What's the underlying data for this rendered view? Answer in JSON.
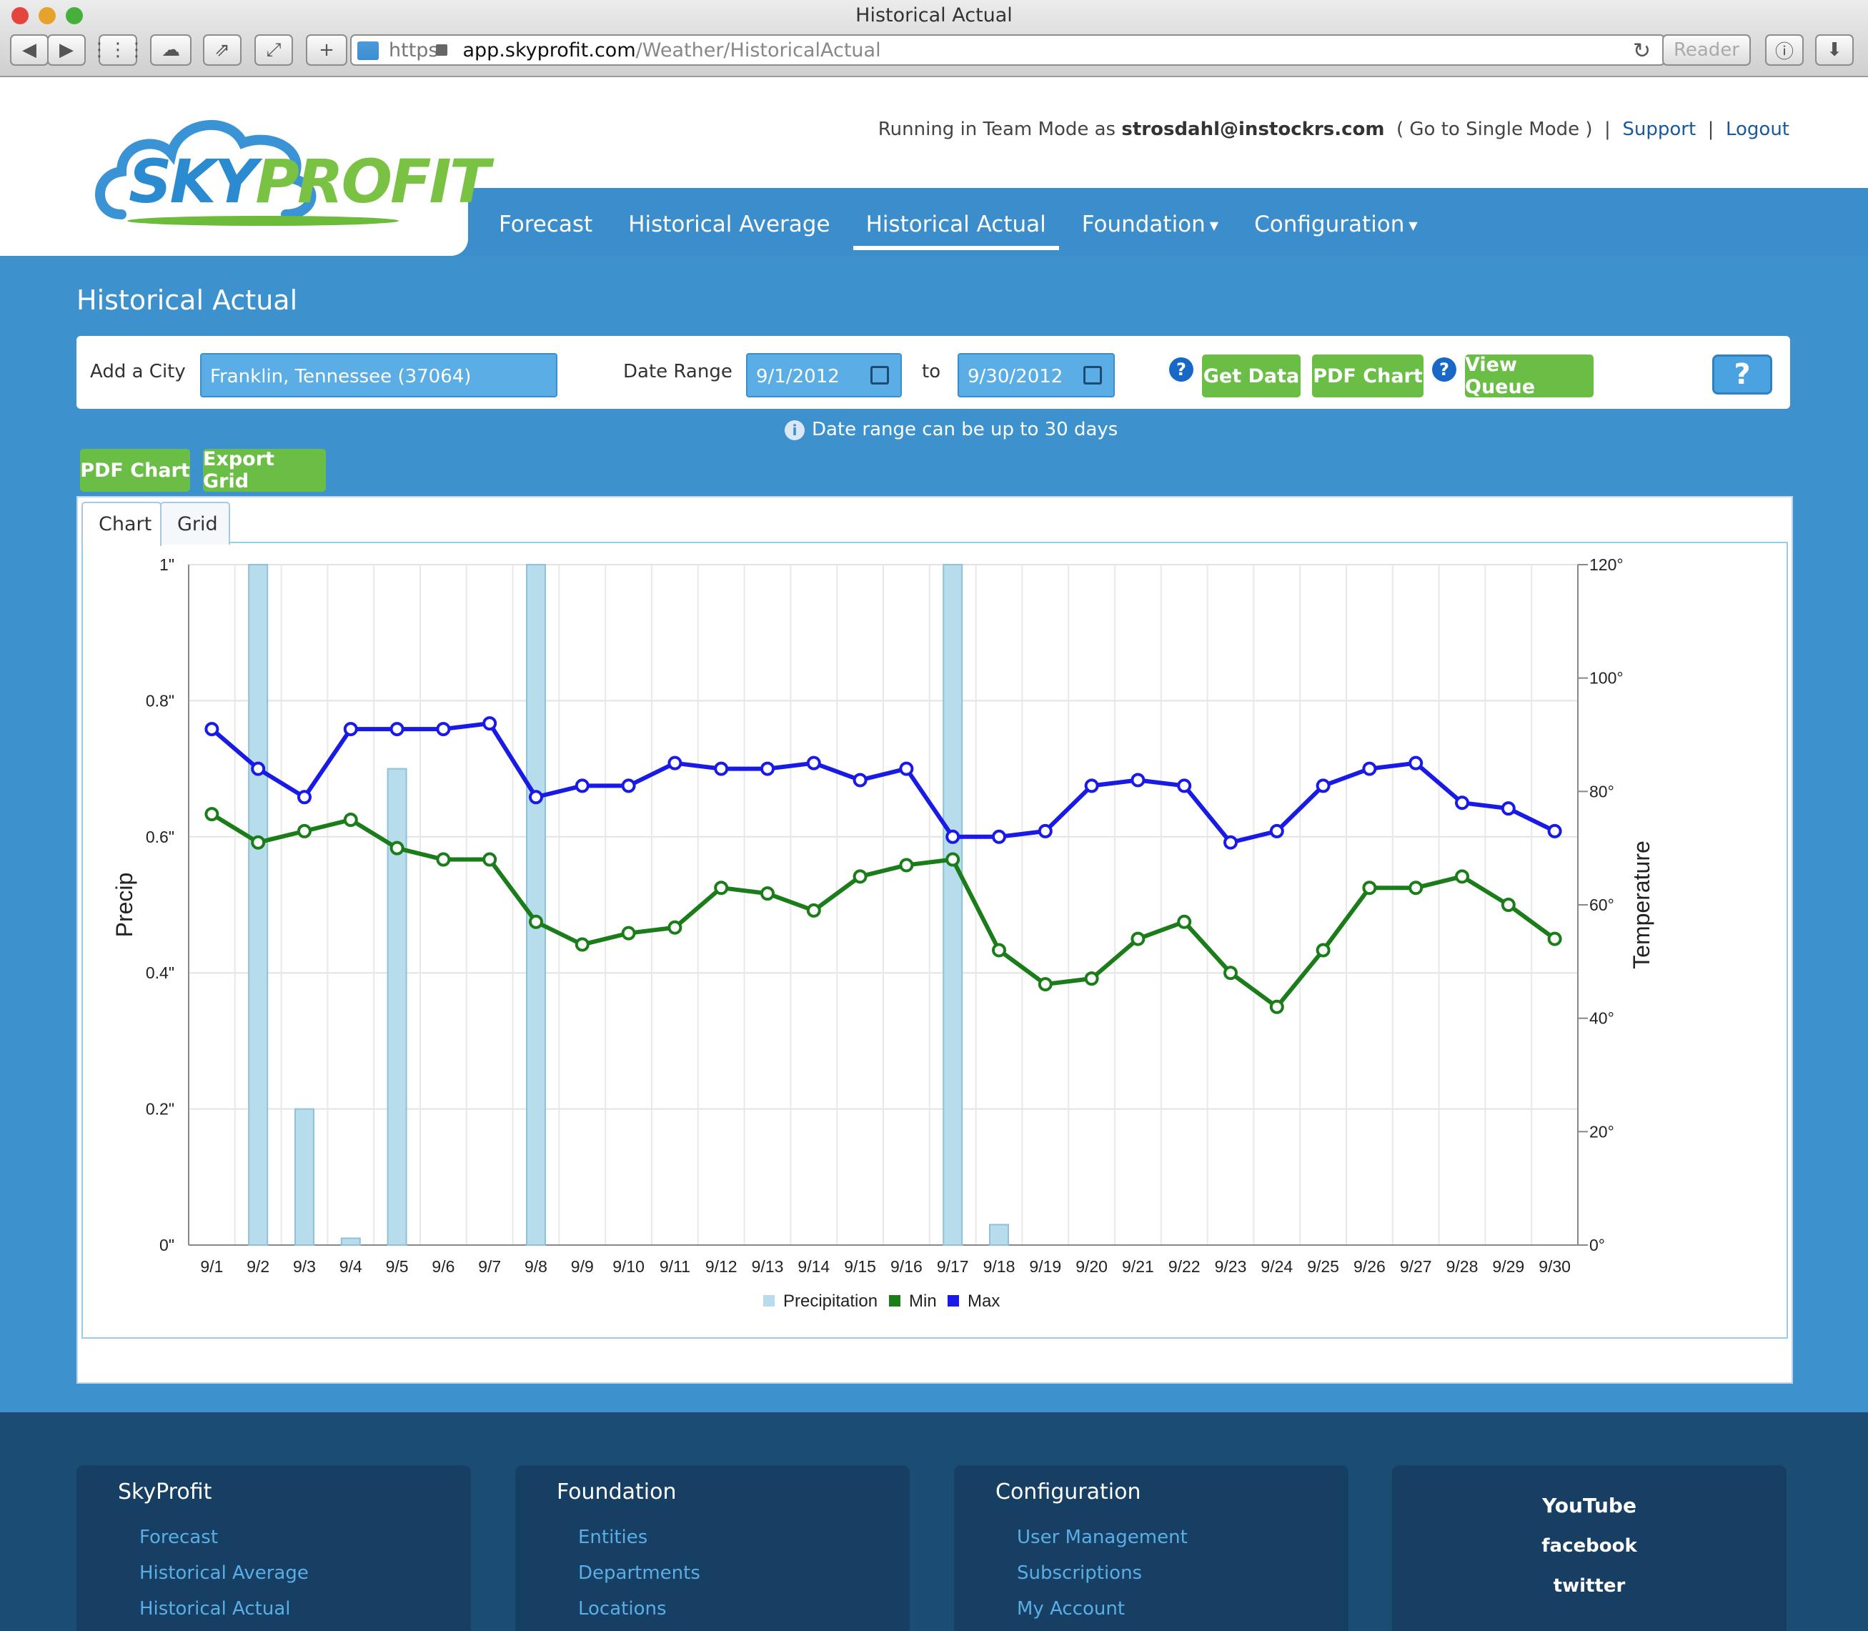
{
  "browser": {
    "window_title": "Historical Actual",
    "url_scheme": "https",
    "url_host": "app.skyprofit.com",
    "url_path": "/Weather/HistoricalActual",
    "reader_label": "Reader"
  },
  "header": {
    "logo_sky": "SKY",
    "logo_profit": "PROFIT",
    "user_prefix": "Running in Team Mode as",
    "user_email": "strosdahl@instockrs.com",
    "single_mode": "( Go to Single Mode )",
    "support": "Support",
    "logout": "Logout",
    "nav": [
      "Forecast",
      "Historical Average",
      "Historical Actual",
      "Foundation",
      "Configuration"
    ]
  },
  "page": {
    "title": "Historical Actual",
    "add_city_label": "Add a City",
    "city_value": "Franklin, Tennessee (37064)",
    "date_range_label": "Date Range",
    "date_from": "9/1/2012",
    "to_label": "to",
    "date_to": "9/30/2012",
    "get_data": "Get Data",
    "pdf_chart": "PDF Chart",
    "view_queue": "View Queue",
    "note": "Date range can be up to 30 days",
    "pdf_chart_2": "PDF Chart",
    "export_grid": "Export Grid",
    "tab_chart": "Chart",
    "tab_grid": "Grid"
  },
  "chart_data": {
    "type": "bar+line",
    "categories": [
      "9/1",
      "9/2",
      "9/3",
      "9/4",
      "9/5",
      "9/6",
      "9/7",
      "9/8",
      "9/9",
      "9/10",
      "9/11",
      "9/12",
      "9/13",
      "9/14",
      "9/15",
      "9/16",
      "9/17",
      "9/18",
      "9/19",
      "9/20",
      "9/21",
      "9/22",
      "9/23",
      "9/24",
      "9/25",
      "9/26",
      "9/27",
      "9/28",
      "9/29",
      "9/30"
    ],
    "y_left_label": "Precip",
    "y_left_ticks": [
      "0\"",
      "0.2\"",
      "0.4\"",
      "0.6\"",
      "0.8\"",
      "1\""
    ],
    "y_left_range": [
      0,
      1
    ],
    "y_right_label": "Temperature",
    "y_right_ticks": [
      "0°",
      "20°",
      "40°",
      "60°",
      "80°",
      "100°",
      "120°"
    ],
    "y_right_range": [
      0,
      120
    ],
    "precipitation": [
      0,
      1,
      0.2,
      0.01,
      0.7,
      0,
      0,
      1,
      0,
      0,
      0,
      0,
      0,
      0,
      0,
      0,
      1,
      0.03,
      0,
      0,
      0,
      0,
      0,
      0,
      0,
      0,
      0,
      0,
      0,
      0
    ],
    "min": [
      76,
      71,
      73,
      75,
      70,
      68,
      68,
      57,
      53,
      55,
      56,
      63,
      62,
      59,
      65,
      67,
      68,
      52,
      46,
      47,
      54,
      57,
      48,
      42,
      52,
      63,
      63,
      65,
      60,
      54
    ],
    "max": [
      91,
      84,
      79,
      91,
      91,
      91,
      92,
      79,
      81,
      81,
      85,
      84,
      84,
      85,
      82,
      84,
      72,
      72,
      73,
      81,
      82,
      81,
      71,
      73,
      81,
      84,
      85,
      78,
      77,
      73
    ],
    "legend": [
      "Precipitation",
      "Min",
      "Max"
    ],
    "colors": {
      "precip": "#b7dceb",
      "min": "#1a7d1a",
      "max": "#1a1ae6"
    },
    "grid": true,
    "legend_position": "bottom"
  },
  "footer": {
    "col1": {
      "title": "SkyProfit",
      "links": [
        "Forecast",
        "Historical Average",
        "Historical Actual"
      ]
    },
    "col2": {
      "title": "Foundation",
      "links": [
        "Entities",
        "Departments",
        "Locations"
      ]
    },
    "col3": {
      "title": "Configuration",
      "links": [
        "User Management",
        "Subscriptions",
        "My Account"
      ]
    },
    "social": [
      "YouTube",
      "facebook",
      "twitter"
    ]
  }
}
